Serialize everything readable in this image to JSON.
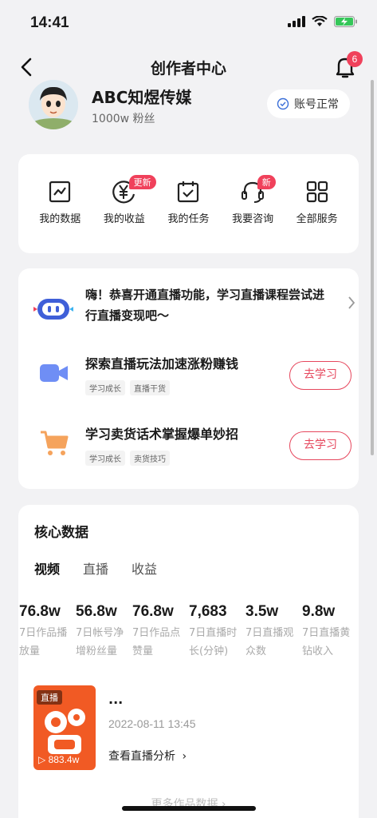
{
  "status": {
    "time": "14:41"
  },
  "nav": {
    "title": "创作者中心",
    "notification_count": "6"
  },
  "profile": {
    "name": "ABC知煜传媒",
    "fans": "1000w 粉丝",
    "account_status": "账号正常"
  },
  "services": [
    {
      "label": "我的数据",
      "icon": "chart-icon",
      "badge": ""
    },
    {
      "label": "我的收益",
      "icon": "yuan-icon",
      "badge": "更新"
    },
    {
      "label": "我的任务",
      "icon": "calendar-check-icon",
      "badge": ""
    },
    {
      "label": "我要咨询",
      "icon": "headset-icon",
      "badge": "新"
    },
    {
      "label": "全部服务",
      "icon": "grid-icon",
      "badge": ""
    }
  ],
  "live_promo": {
    "headline": "嗨！恭喜开通直播功能，学习直播课程尝试进行直播变现吧～",
    "rows": [
      {
        "title": "探索直播玩法加速涨粉赚钱",
        "tags": [
          "学习成长",
          "直播干货"
        ],
        "button": "去学习",
        "icon": "video-camera-icon",
        "color": "#6f8ef5"
      },
      {
        "title": "学习卖货话术掌握爆单妙招",
        "tags": [
          "学习成长",
          "卖货技巧"
        ],
        "button": "去学习",
        "icon": "shopping-cart-icon",
        "color": "#f5a35c"
      }
    ]
  },
  "core": {
    "title": "核心数据",
    "tabs": [
      "视频",
      "直播",
      "收益"
    ],
    "active_tab": "视频",
    "metrics": [
      {
        "value": "76.8w",
        "label": "7日作品播放量"
      },
      {
        "value": "56.8w",
        "label": "7日帐号净增粉丝量"
      },
      {
        "value": "76.8w",
        "label": "7日作品点赞量"
      },
      {
        "value": "7,683",
        "label": "7日直播时长(分钟)"
      },
      {
        "value": "3.5w",
        "label": "7日直播观众数"
      },
      {
        "value": "9.8w",
        "label": "7日直播黄钻收入"
      }
    ],
    "work": {
      "tag": "直播",
      "views": "883.4w",
      "title": "...",
      "date": "2022-08-11 13:45",
      "link": "查看直播分析"
    },
    "more": "更多作品数据"
  },
  "colors": {
    "accent": "#e6475d",
    "badge": "#f0415b",
    "background": "#f2f2f4"
  }
}
